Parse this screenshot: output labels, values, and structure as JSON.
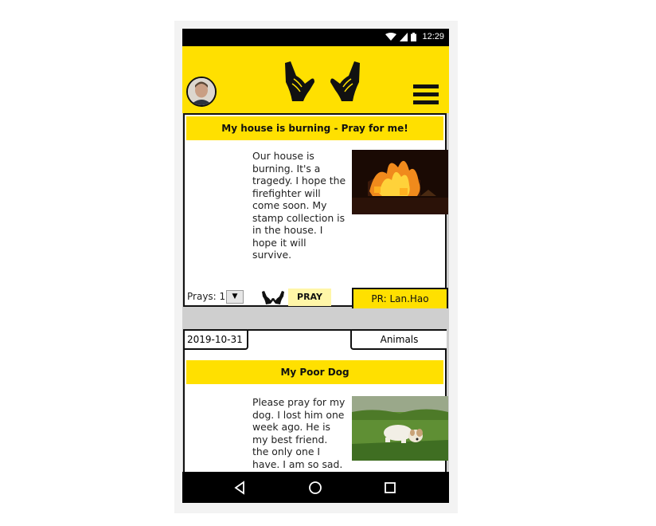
{
  "status_bar": {
    "time": "12:29",
    "icons": [
      "wifi-icon",
      "signal-icon",
      "battery-icon"
    ]
  },
  "header": {
    "logo": "praying-hands-logo",
    "menu_icon": "hamburger-menu-icon",
    "avatar": "user-avatar"
  },
  "posts": [
    {
      "title": "My house is burning - Pray for me!",
      "body": "Our house is burning. It's a tragedy. I hope the firefighter will come soon. My stamp collection is in the house. I hope it will survive.",
      "image": "burning-house",
      "prays_label": "Prays: 1",
      "pray_button": "PRAY",
      "pr_tag": "PR: Lan.Hao"
    },
    {
      "date": "2019-10-31",
      "category": "Animals",
      "title": "My Poor Dog",
      "body": "Please pray for my dog. I lost him one week ago. He is my best friend. the only one I have. I am so sad.",
      "image": "puppy-in-grass"
    }
  ],
  "navigation": {
    "buttons": [
      "back-icon",
      "home-icon",
      "recents-icon"
    ]
  },
  "colors": {
    "accent": "#ffe000",
    "pray_button_bg": "#fff6a8",
    "separator": "#cfcfcf"
  }
}
